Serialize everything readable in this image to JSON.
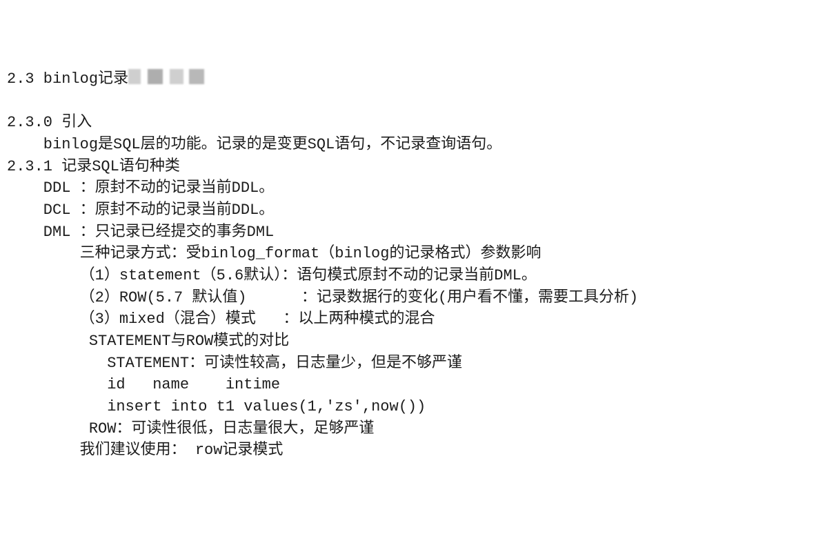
{
  "lines": [
    "2.3 binlog记录",
    "",
    "2.3.0 引入",
    "    binlog是SQL层的功能。记录的是变更SQL语句，不记录查询语句。",
    "2.3.1 记录SQL语句种类",
    "    DDL ：原封不动的记录当前DDL。",
    "    DCL ：原封不动的记录当前DDL。",
    "    DML ：只记录已经提交的事务DML",
    "        三种记录方式：受binlog_format（binlog的记录格式）参数影响",
    "        （1）statement（5.6默认）：语句模式原封不动的记录当前DML。",
    "        （2）ROW(5.7 默认值)      ：记录数据行的变化(用户看不懂，需要工具分析)",
    "        （3）mixed（混合）模式   ：以上两种模式的混合",
    "         STATEMENT与ROW模式的对比",
    "           STATEMENT：可读性较高，日志量少，但是不够严谨",
    "           id   name    intime",
    "           insert into t1 values(1,'zs',now())",
    "         ROW：可读性很低，日志量很大，足够严谨",
    "        我们建议使用： row记录模式"
  ],
  "redacted_on_line": 0
}
